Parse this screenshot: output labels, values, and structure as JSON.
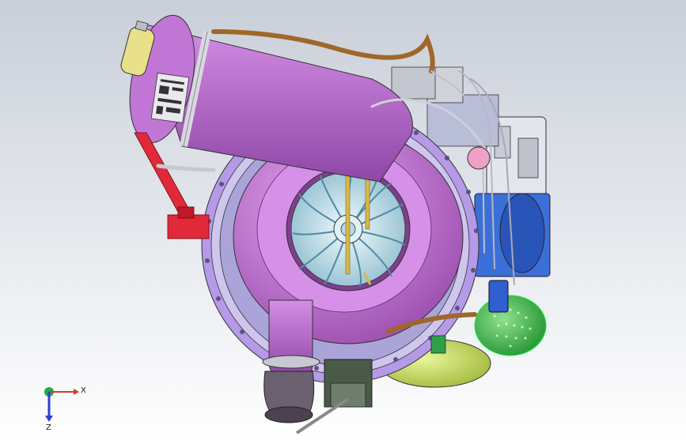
{
  "viewport": {
    "background_top": "#c9cfd9",
    "background_bottom": "#ffffff"
  },
  "triad": {
    "x_label": "X",
    "z_label": "Z",
    "x_color": "#d23c2c",
    "y_color": "#2aa84a",
    "z_color": "#2c3fd2"
  },
  "model": {
    "housing_color": "#c878d8",
    "housing_dark": "#9c4fb0",
    "duct_color": "#b96ad0",
    "clamp_color": "#d8d8e0",
    "pipe_color": "#a0672a",
    "bracket_color": "#e02a3a",
    "flange_color": "#8a7ae0",
    "impeller_color": "#cfeaf0",
    "impeller_blade": "#6aa0b8",
    "rod_color": "#d8b84a",
    "green_part": "#3fbf4a",
    "yellow_part": "#c8e05a",
    "blue_part": "#3b6fd8",
    "tank_color": "#e8e08a"
  }
}
